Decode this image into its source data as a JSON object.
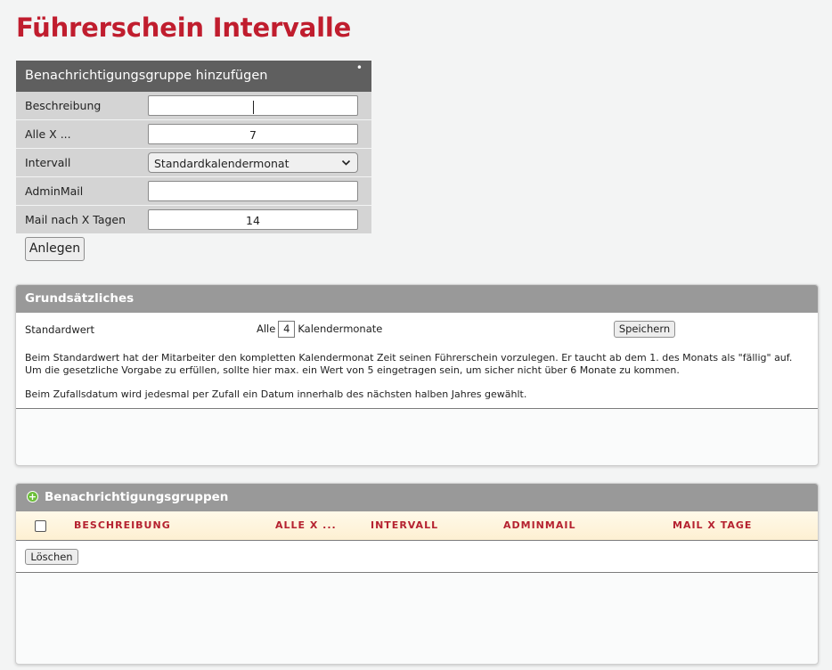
{
  "page": {
    "title": "Führerschein Intervalle"
  },
  "add_form": {
    "title": "Benachrichtigungsgruppe hinzufügen",
    "marker": "•",
    "fields": [
      {
        "label": "Beschreibung",
        "value": ""
      },
      {
        "label": "Alle X ...",
        "value": "7"
      },
      {
        "label": "Intervall",
        "value": "Standardkalendermonat"
      },
      {
        "label": "AdminMail",
        "value": ""
      },
      {
        "label": "Mail nach X Tagen",
        "value": "14"
      }
    ],
    "submit_label": "Anlegen"
  },
  "grundsaetzliches": {
    "title": "Grundsätzliches",
    "standard_label": "Standardwert",
    "alle_prefix": "Alle",
    "alle_value": "4",
    "alle_suffix": "Kalendermonate",
    "save_label": "Speichern",
    "desc_line1": "Beim Standardwert hat der Mitarbeiter den kompletten Kalendermonat Zeit seinen Führerschein vorzulegen. Er taucht ab dem 1. des Monats als \"fällig\" auf.",
    "desc_line2": "Um die gesetzliche Vorgabe zu erfüllen, sollte hier max. ein Wert von 5 eingetragen sein, um sicher nicht über 6 Monate zu kommen.",
    "desc_line3": "Beim Zufallsdatum wird jedesmal per Zufall ein Datum innerhalb des nächsten halben Jahres gewählt."
  },
  "groups": {
    "title": "Benachrichtigungsgruppen",
    "columns": [
      "BESCHREIBUNG",
      "ALLE X ...",
      "INTERVALL",
      "ADMINMAIL",
      "MAIL X TAGE"
    ],
    "delete_label": "Löschen"
  },
  "colors": {
    "title_red": "#c01d2e",
    "header_red": "#b52230",
    "add_icon_green": "#6cbf3a"
  }
}
